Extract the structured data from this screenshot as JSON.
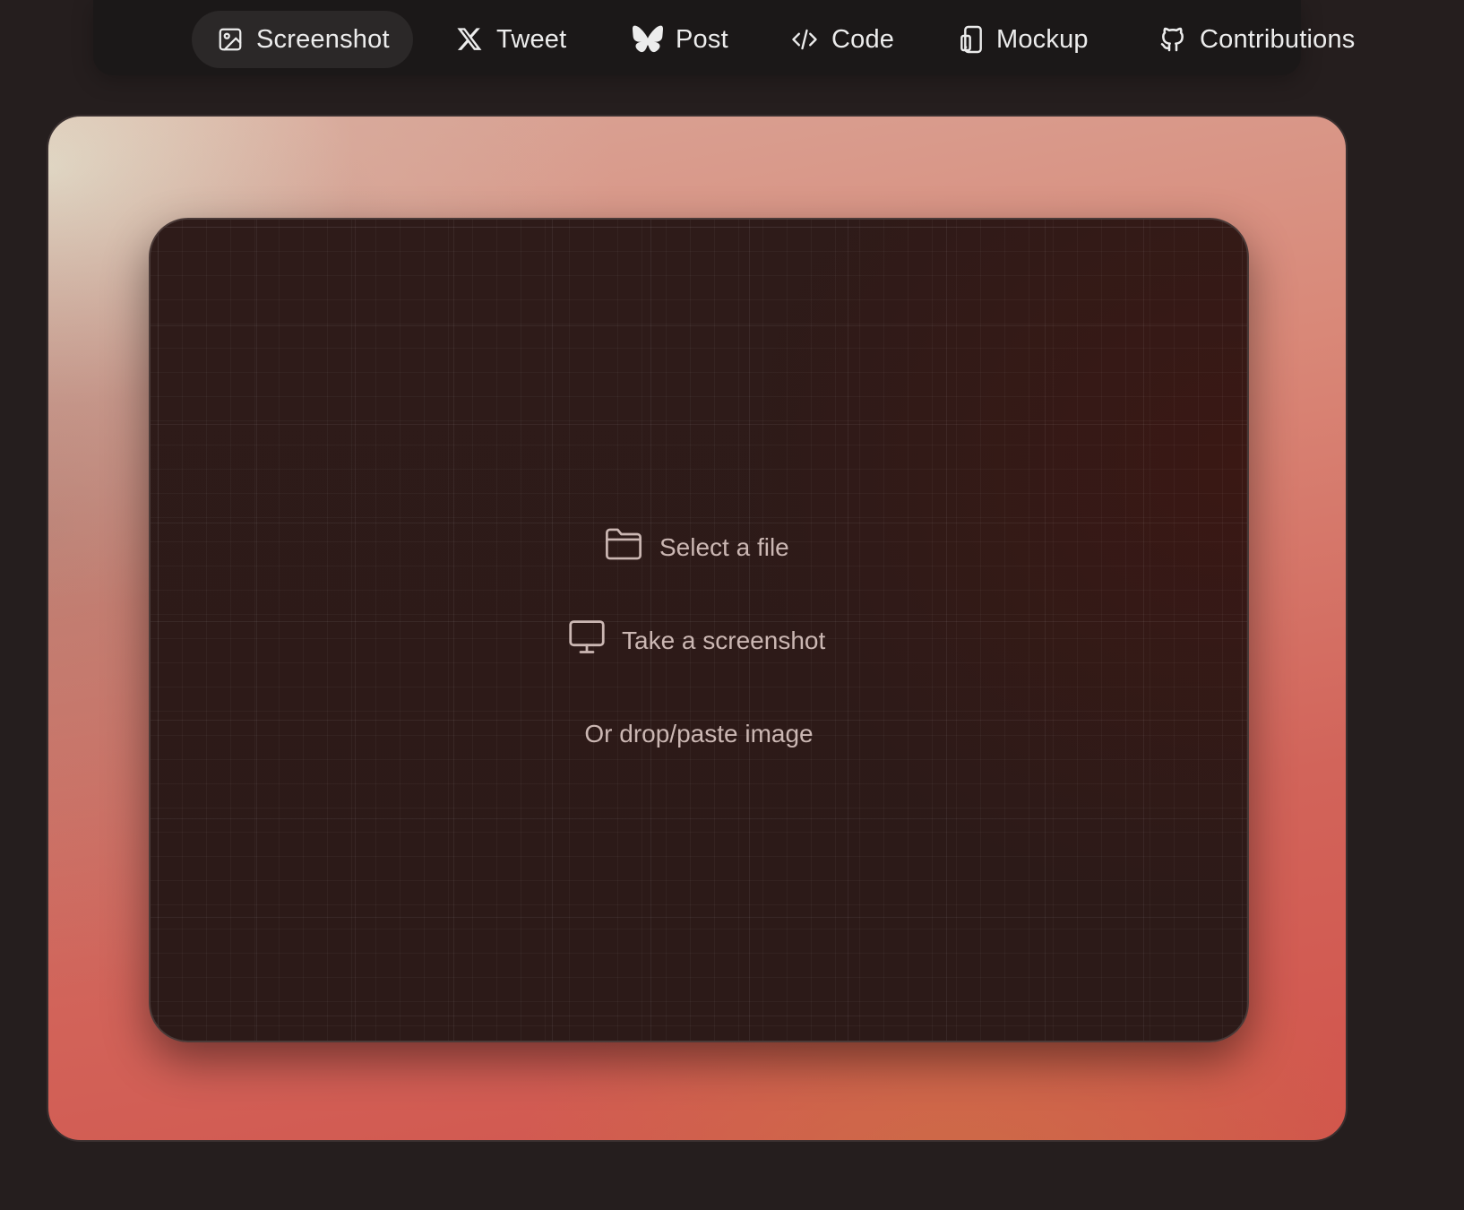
{
  "tabs": [
    {
      "label": "Screenshot",
      "icon": "image-icon",
      "active": true
    },
    {
      "label": "Tweet",
      "icon": "x-logo-icon",
      "active": false
    },
    {
      "label": "Post",
      "icon": "butterfly-icon",
      "active": false
    },
    {
      "label": "Code",
      "icon": "code-icon",
      "active": false
    },
    {
      "label": "Mockup",
      "icon": "phone-mockup-icon",
      "active": false
    },
    {
      "label": "Contributions",
      "icon": "github-icon",
      "active": false
    }
  ],
  "dropzone": {
    "select_file": "Select a file",
    "take_screenshot": "Take a screenshot",
    "hint": "Or drop/paste image"
  },
  "colors": {
    "page_bg": "#251e1e",
    "topbar_bg": "#1b1818",
    "active_tab_bg": "#2b2828",
    "gradient_light": "#e8e1cd",
    "gradient_coral": "#d2544c",
    "dropzone_bg": "#2e1b19"
  }
}
